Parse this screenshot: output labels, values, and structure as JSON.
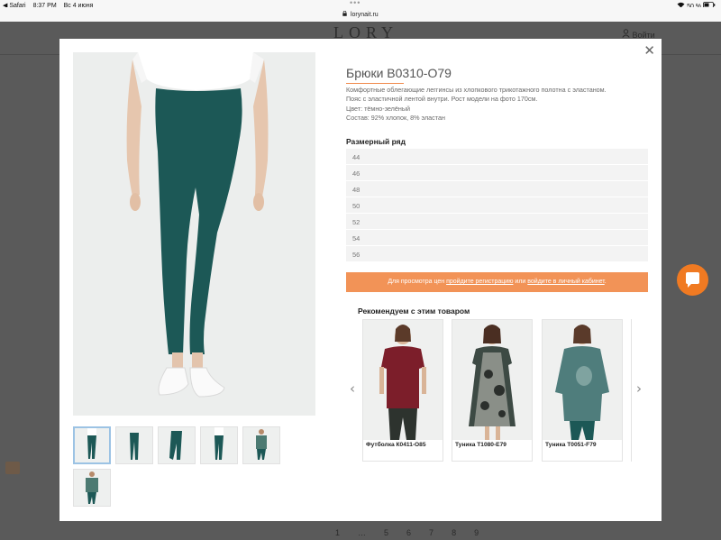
{
  "status_bar": {
    "back_app": "◀ Safari",
    "time": "8:37 PM",
    "date": "Вс 4 июня",
    "wifi_battery": "50 %"
  },
  "browser": {
    "url": "lorynait.ru",
    "menu_dots": "•••"
  },
  "site": {
    "logo": "LORY",
    "account_label": "Войти",
    "pagination": [
      "1",
      "…",
      "5",
      "6",
      "7",
      "8",
      "9"
    ]
  },
  "product": {
    "title": "Брюки В0310-О79",
    "description": [
      "Комфортные облегающие леггинсы из хлопкового трикотажного полотна с эластаном.",
      "Пояс с эластичной лентой внутри. Рост модели на фото 170см.",
      "Цвет: тёмно-зелёный",
      "Состав: 92% хлопок, 8% эластан"
    ],
    "sizes_title": "Размерный ряд",
    "sizes": [
      "44",
      "46",
      "48",
      "50",
      "52",
      "54",
      "56"
    ],
    "price_notice": {
      "prefix": "Для просмотра цен",
      "register_link": "пройдите регистрацию",
      "middle": "или",
      "login_link": "войдите в личный кабинет",
      "suffix": "."
    }
  },
  "recommendations": {
    "title": "Рекомендуем с этим товаром",
    "prev_arrow": "‹",
    "next_arrow": "›",
    "items": [
      {
        "name": "Футболка К0411-О85"
      },
      {
        "name": "Туника Т1080-Е79"
      },
      {
        "name": "Туника Т0051-F79"
      }
    ]
  },
  "colors": {
    "accent": "#f29357",
    "chat": "#f07a22",
    "leggings": "#1c5856",
    "overlay": "#5a5a5a"
  },
  "icons": {
    "close": "close-icon",
    "chat": "chat-bubble-icon",
    "lock": "lock-icon",
    "wifi": "wifi-icon",
    "battery": "battery-icon"
  },
  "close_symbol": "✕"
}
